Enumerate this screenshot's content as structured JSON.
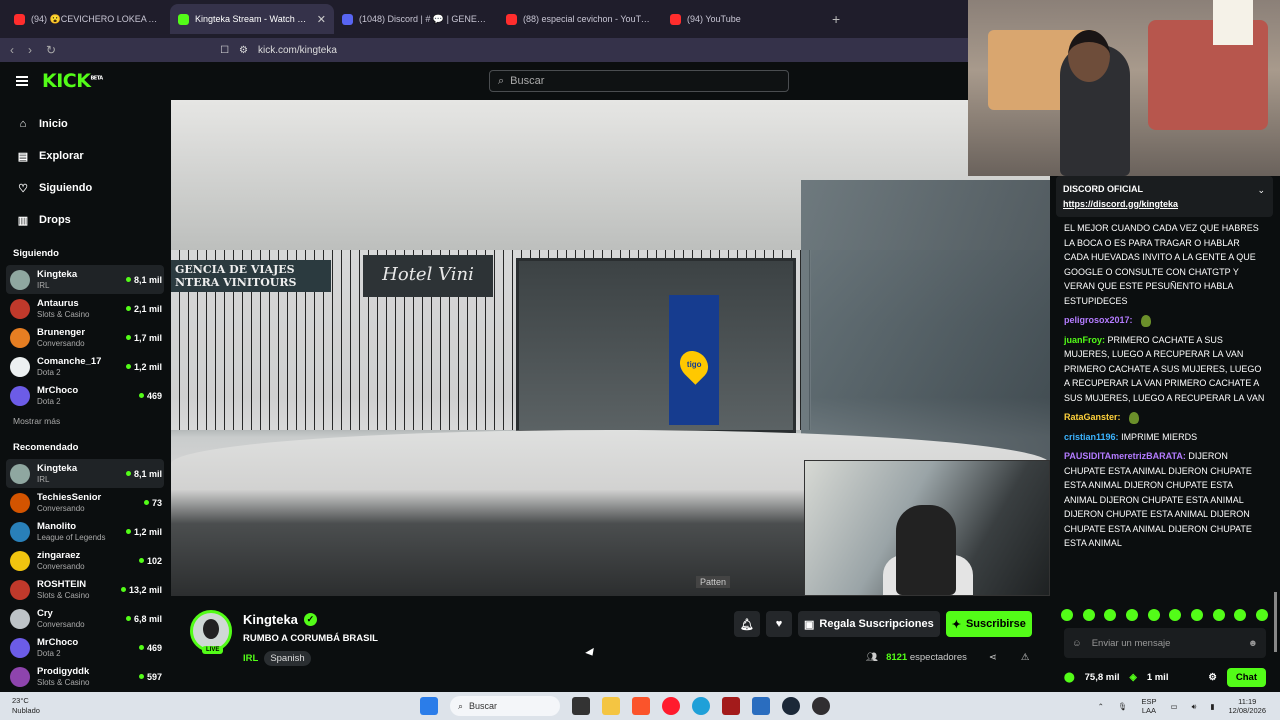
{
  "browser": {
    "tabs": [
      {
        "title": "(94) 😮CEVICHERO LOKEA A SHAKA",
        "color": "#ff2d2d"
      },
      {
        "title": "Kingteka Stream - Watch Live",
        "color": "#53fc18"
      },
      {
        "title": "(1048) Discord | # 💬 | GENERAL | EISUS",
        "color": "#5865f2"
      },
      {
        "title": "(88) especial cevichon - YouTube",
        "color": "#ff2d2d"
      },
      {
        "title": "(94) YouTube",
        "color": "#ff2d2d"
      }
    ],
    "url": "kick.com/kingteka"
  },
  "header": {
    "logo": "KICK",
    "logo_sup": "BETA",
    "search_placeholder": "Buscar"
  },
  "sidebar": {
    "nav": [
      {
        "label": "Inicio",
        "icon": "home-icon"
      },
      {
        "label": "Explorar",
        "icon": "compass-icon"
      },
      {
        "label": "Siguiendo",
        "icon": "heart-icon"
      },
      {
        "label": "Drops",
        "icon": "drops-icon"
      }
    ],
    "following_title": "Siguiendo",
    "following": [
      {
        "name": "Kingteka",
        "category": "IRL",
        "viewers": "8,1 mil",
        "color": "#8fa7a0"
      },
      {
        "name": "Antaurus",
        "category": "Slots & Casino",
        "viewers": "2,1 mil",
        "color": "#c0392b"
      },
      {
        "name": "Brunenger",
        "category": "Conversando",
        "viewers": "1,7 mil",
        "color": "#e67e22"
      },
      {
        "name": "Comanche_17",
        "category": "Dota 2",
        "viewers": "1,2 mil",
        "color": "#ecf0f1"
      },
      {
        "name": "MrChoco",
        "category": "Dota 2",
        "viewers": "469",
        "color": "#6c5ce7"
      }
    ],
    "more_label": "Mostrar más",
    "recommended_title": "Recomendado",
    "recommended": [
      {
        "name": "Kingteka",
        "category": "IRL",
        "viewers": "8,1 mil",
        "color": "#8fa7a0"
      },
      {
        "name": "TechiesSenior",
        "category": "Conversando",
        "viewers": "73",
        "color": "#d35400"
      },
      {
        "name": "Manolito",
        "category": "League of Legends",
        "viewers": "1,2 mil",
        "color": "#2980b9"
      },
      {
        "name": "zingaraez",
        "category": "Conversando",
        "viewers": "102",
        "color": "#f1c40f"
      },
      {
        "name": "ROSHTEIN",
        "category": "Slots & Casino",
        "viewers": "13,2 mil",
        "color": "#c0392b"
      },
      {
        "name": "Cry",
        "category": "Conversando",
        "viewers": "6,8 mil",
        "color": "#bdc3c7"
      },
      {
        "name": "MrChoco",
        "category": "Dota 2",
        "viewers": "469",
        "color": "#6c5ce7"
      },
      {
        "name": "Prodigyddk",
        "category": "Slots & Casino",
        "viewers": "597",
        "color": "#8e44ad"
      }
    ]
  },
  "video": {
    "sign_left": "GENCIA DE VIAJES\nNTERA VINITOURS",
    "sign_hotel": "Hotel Vini",
    "tigo": "tigo",
    "watermark": "Patten"
  },
  "stream": {
    "name": "Kingteka",
    "live_badge": "LIVE",
    "title": "RUMBO A CORUMBÁ BRASIL",
    "category": "IRL",
    "language": "Spanish",
    "gift_label": "Regala Suscripciones",
    "subscribe_label": "Suscribirse",
    "viewers": "8121",
    "viewers_label": "espectadores"
  },
  "chat": {
    "pinned_title": "DISCORD OFICIAL",
    "pinned_link": "https://discord.gg/kingteka",
    "messages": [
      {
        "user": "",
        "text": "EL MEJOR CUANDO CADA VEZ QUE HABRES LA BOCA O ES PARA TRAGAR O HABLAR CADA HUEVADAS INVITO A LA GENTE A QUE GOOGLE O CONSULTE CON CHATGTP Y VERAN QUE ESTE PESUÑENTO HABLA ESTUPIDECES",
        "color": "#ffffff"
      },
      {
        "user": "peligrosox2017:",
        "text": "",
        "color": "#b47cff"
      },
      {
        "user": "juanFroy:",
        "text": "PRIMERO CACHATE A SUS MUJERES, LUEGO A RECUPERAR LA VAN PRIMERO CACHATE A SUS MUJERES, LUEGO A RECUPERAR LA VAN PRIMERO CACHATE A SUS MUJERES, LUEGO A RECUPERAR LA VAN",
        "color": "#53fc18"
      },
      {
        "user": "RataGanster:",
        "text": "",
        "color": "#ffd23c"
      },
      {
        "user": "cristian1196:",
        "text": "IMPRIME MIERDS",
        "color": "#3cb4ff"
      },
      {
        "user": "PAUSIDITAmeretrizBARATA:",
        "text": "DIJERON CHUPATE ESTA ANIMAL DIJERON CHUPATE ESTA ANIMAL DIJERON CHUPATE ESTA ANIMAL DIJERON CHUPATE ESTA ANIMAL DIJERON CHUPATE ESTA ANIMAL DIJERON CHUPATE ESTA ANIMAL DIJERON CHUPATE ESTA ANIMAL",
        "color": "#b47cff"
      }
    ],
    "input_placeholder": "Enviar un mensaje",
    "points": "75,8 mil",
    "coins": "1 mil",
    "send_label": "Chat"
  },
  "taskbar": {
    "temp": "23°C",
    "weather": "Nublado",
    "search": "Buscar",
    "lang": "ESP",
    "lang2": "LAA",
    "time": "11:19",
    "date": "12/08/2026"
  }
}
